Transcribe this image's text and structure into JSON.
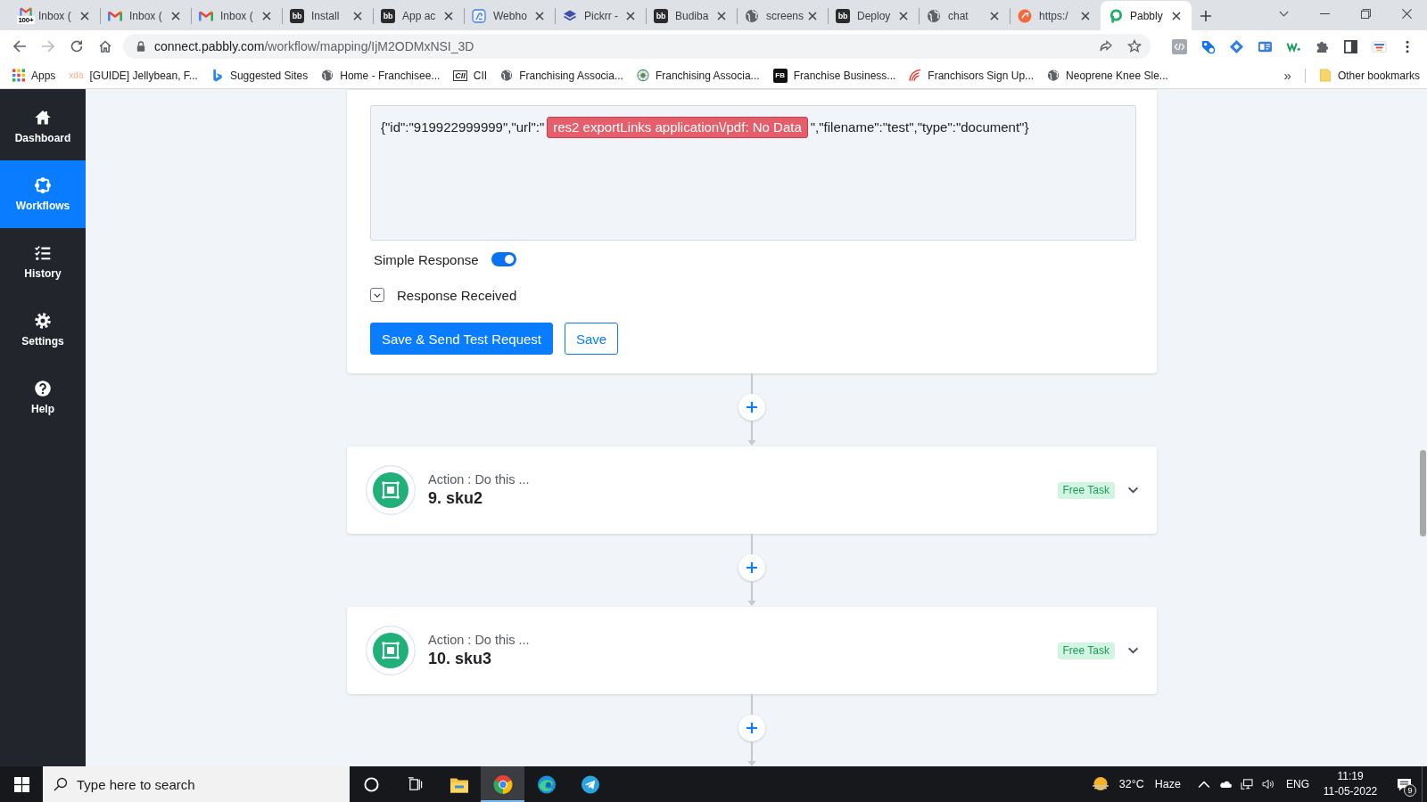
{
  "browser": {
    "tabs": [
      {
        "kind": "mail",
        "badge": "100+",
        "title": "Inbox (",
        "selected": false
      },
      {
        "kind": "mail",
        "title": "Inbox (",
        "selected": false
      },
      {
        "kind": "mail",
        "title": "Inbox (",
        "selected": false
      },
      {
        "kind": "tile",
        "icon_text": "bb",
        "title": "Install",
        "selected": false
      },
      {
        "kind": "tile",
        "icon_text": "bb",
        "title": "App ac",
        "selected": false
      },
      {
        "kind": "hook",
        "title": "Webho",
        "selected": false
      },
      {
        "kind": "stack",
        "title": "Pickrr -",
        "selected": false
      },
      {
        "kind": "tile",
        "icon_text": "bb",
        "title": "Budiba",
        "selected": false
      },
      {
        "kind": "globe",
        "title": "screens",
        "selected": false
      },
      {
        "kind": "tile",
        "icon_text": "bb",
        "title": "Deploy",
        "selected": false
      },
      {
        "kind": "globe",
        "title": "chat",
        "selected": false
      },
      {
        "kind": "disc",
        "title": "https:/",
        "selected": false
      },
      {
        "kind": "ring",
        "title": "Pabbly",
        "selected": true
      }
    ],
    "address": {
      "host": "connect.pabbly.com",
      "path": "/workflow/mapping/IjM2ODMxNSI_3D"
    },
    "bookmarks": [
      {
        "kind": "grid",
        "label": "Apps"
      },
      {
        "kind": "faded",
        "icon_text": "xda",
        "label": "[GUIDE] Jellybean, F..."
      },
      {
        "kind": "ribbon",
        "label": "Suggested Sites"
      },
      {
        "kind": "globe",
        "label": "Home - Franchisee..."
      },
      {
        "kind": "boxed",
        "icon_text": "CII",
        "label": "CII"
      },
      {
        "kind": "globe",
        "label": "Franchising Associa..."
      },
      {
        "kind": "medal",
        "label": "Franchising Associa..."
      },
      {
        "kind": "tile",
        "icon_text": "FB",
        "label": "Franchise Business..."
      },
      {
        "kind": "arc",
        "label": "Franchisors Sign Up..."
      },
      {
        "kind": "globe",
        "label": "Neoprene Knee Sle..."
      }
    ],
    "more": "»",
    "other_bookmarks": "Other bookmarks"
  },
  "sidebar": {
    "items": [
      {
        "kind": "home",
        "label": "Dashboard",
        "selected": false
      },
      {
        "kind": "workflows",
        "label": "Workflows",
        "selected": true
      },
      {
        "kind": "history",
        "label": "History",
        "selected": false
      },
      {
        "kind": "settings",
        "label": "Settings",
        "selected": false
      },
      {
        "kind": "help",
        "label": "Help",
        "selected": false
      }
    ]
  },
  "editor": {
    "body": [
      {
        "kind": "text",
        "text": "{\"id\":\"919922999999\",\"url\":\""
      },
      {
        "kind": "token",
        "text": "res2 exportLinks application\\/pdf: No Data"
      },
      {
        "kind": "text",
        "text": "\",\"filename\":\"test\",\"type\":\"document\"}"
      }
    ],
    "simple_response": {
      "label": "Simple Response",
      "on": true
    },
    "response_received": {
      "label": "Response Received",
      "expanded": false
    },
    "buttons": [
      {
        "kind": "primary",
        "label": "Save & Send Test Request"
      },
      {
        "kind": "outline",
        "label": "Save"
      }
    ]
  },
  "steps": [
    {
      "subtitle": "Action : Do this ...",
      "title": "9. sku2",
      "badge": "Free Task",
      "expanded": false
    },
    {
      "subtitle": "Action : Do this ...",
      "title": "10. sku3",
      "badge": "Free Task",
      "expanded": false
    }
  ],
  "taskbar": {
    "search": {
      "placeholder": "Type here to search"
    },
    "apps": [
      {
        "kind": "ring",
        "selected": false
      },
      {
        "kind": "panes",
        "selected": false
      },
      {
        "kind": "folder",
        "selected": false
      },
      {
        "kind": "wheel",
        "selected": true
      },
      {
        "kind": "wave",
        "selected": false
      },
      {
        "kind": "plane",
        "selected": false
      }
    ],
    "weather": {
      "temperature": "32°C",
      "condition": "Haze"
    },
    "language": "ENG",
    "time": "11:19",
    "date": "11-05-2022",
    "notifications": "9"
  }
}
